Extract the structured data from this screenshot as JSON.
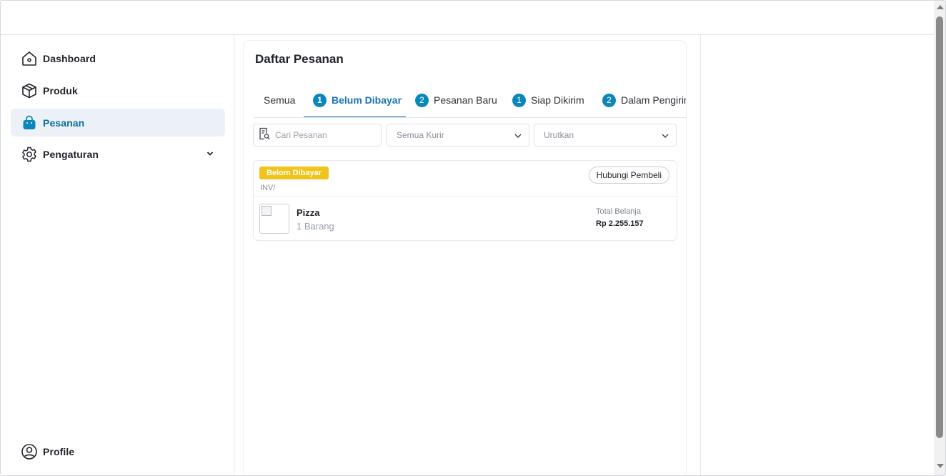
{
  "sidebar": {
    "items": [
      {
        "label": "Dashboard",
        "icon": "home-icon"
      },
      {
        "label": "Produk",
        "icon": "box-icon"
      },
      {
        "label": "Pesanan",
        "icon": "shopping-bag-icon",
        "active": true
      },
      {
        "label": "Pengaturan",
        "icon": "gear-icon",
        "has_submenu": true
      }
    ],
    "profile_label": "Profile",
    "profile_icon": "user-circle-icon"
  },
  "main": {
    "title": "Daftar Pesanan",
    "tabs": [
      {
        "label": "Semua",
        "count": null
      },
      {
        "label": "Belum Dibayar",
        "count": "1",
        "active": true
      },
      {
        "label": "Pesanan Baru",
        "count": "2"
      },
      {
        "label": "Siap Dikirim",
        "count": "1"
      },
      {
        "label": "Dalam Pengiriman",
        "count": "2"
      }
    ],
    "filters": {
      "search_placeholder": "Cari Pesanan",
      "courier_selected": "Semua Kurir",
      "sort_selected": "Urutkan"
    },
    "orders": [
      {
        "status": "Belom Dibayar",
        "invoice": "INV/",
        "contact_button": "Hubungi Pembeli",
        "product_name": "Pizza",
        "quantity": "1 Barang",
        "total_label": "Total Belanja",
        "total_value": "Rp 2.255.157"
      }
    ]
  },
  "colors": {
    "accent": "#0b86b8",
    "active_nav_bg": "#ebf1f6",
    "status_yellow": "#f0c419"
  }
}
